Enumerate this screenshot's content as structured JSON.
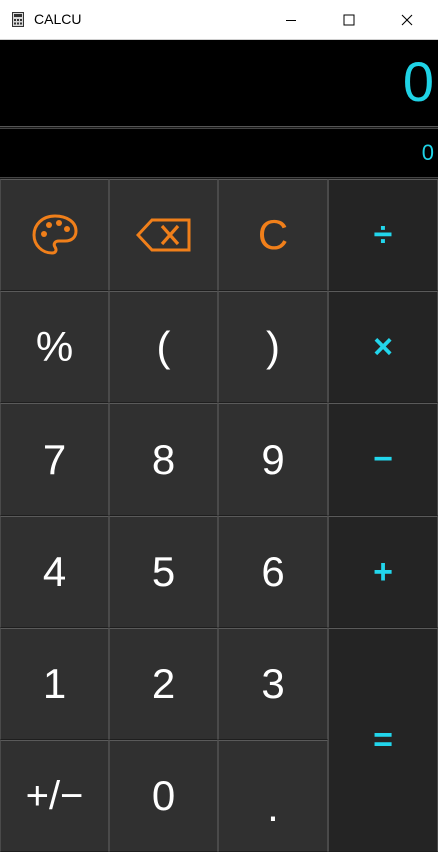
{
  "window": {
    "title": "CALCU",
    "controls": {
      "minimize": "minimize",
      "maximize": "maximize",
      "close": "close"
    }
  },
  "display": {
    "main_value": "0",
    "secondary_value": "0"
  },
  "colors": {
    "accent": "#1fd3e6",
    "orange": "#f07f1a",
    "key_bg": "#303030",
    "op_bg": "#242424",
    "display_bg": "#000000"
  },
  "keys": {
    "theme": {
      "icon": "palette-icon"
    },
    "backspace": {
      "icon": "backspace-icon"
    },
    "clear": "C",
    "divide": "÷",
    "percent": "%",
    "open_paren": "(",
    "close_paren": ")",
    "multiply": "×",
    "seven": "7",
    "eight": "8",
    "nine": "9",
    "minus": "−",
    "four": "4",
    "five": "5",
    "six": "6",
    "plus": "+",
    "one": "1",
    "two": "2",
    "three": "3",
    "equals": "=",
    "negate": "+/−",
    "zero": "0",
    "decimal": "."
  }
}
